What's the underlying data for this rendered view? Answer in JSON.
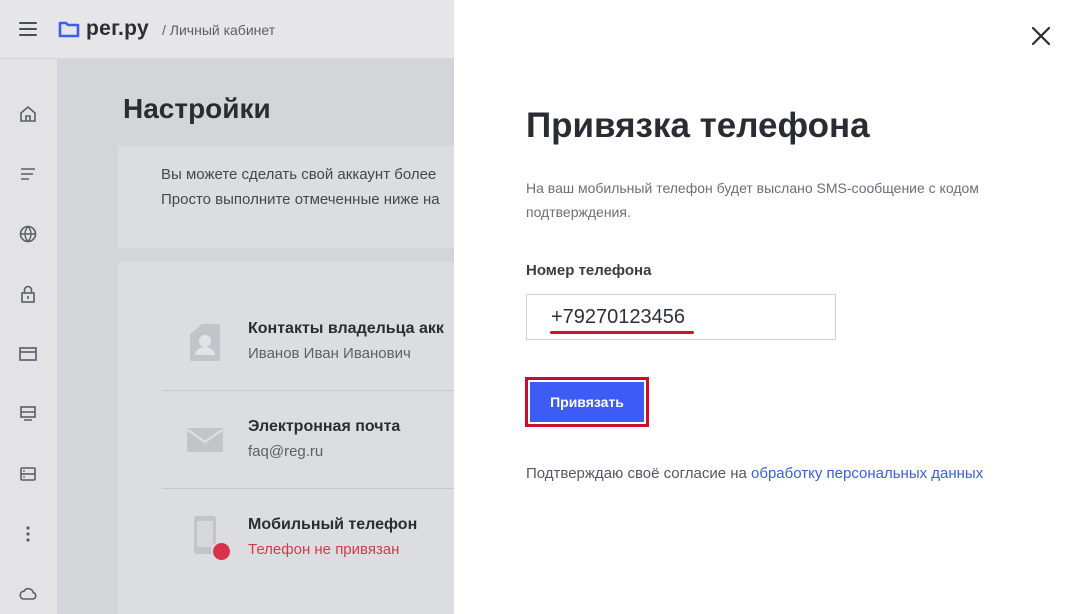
{
  "header": {
    "logo_text": "рег.ру",
    "breadcrumb": "/ Личный кабинет"
  },
  "sidebar": {
    "icons": [
      "home-icon",
      "list-icon",
      "globe-icon",
      "lock-icon",
      "window-icon",
      "server-icon",
      "storage-icon",
      "more-icon",
      "cloud-icon"
    ]
  },
  "page": {
    "title": "Настройки",
    "notice_line1": "Вы можете сделать свой аккаунт более",
    "notice_line2": "Просто выполните отмеченные ниже на",
    "rows": [
      {
        "title": "Контакты владельца акк",
        "subtitle": "Иванов Иван Иванович"
      },
      {
        "title": "Электронная почта",
        "subtitle": "faq@reg.ru"
      },
      {
        "title": "Мобильный телефон",
        "subtitle": "Телефон не привязан"
      }
    ]
  },
  "modal": {
    "title": "Привязка телефона",
    "description": "На ваш мобильный телефон будет выслано SMS-сообщение с кодом подтверждения.",
    "phone_label": "Номер телефона",
    "phone_value": "+79270123456",
    "submit_label": "Привязать",
    "consent_text": "Подтверждаю своё согласие на ",
    "consent_link": "обработку персональных данных"
  },
  "colors": {
    "accent": "#3d5cf5",
    "highlight": "#c8102e",
    "link": "#3a5fd9",
    "status_error": "#d13a4c"
  }
}
